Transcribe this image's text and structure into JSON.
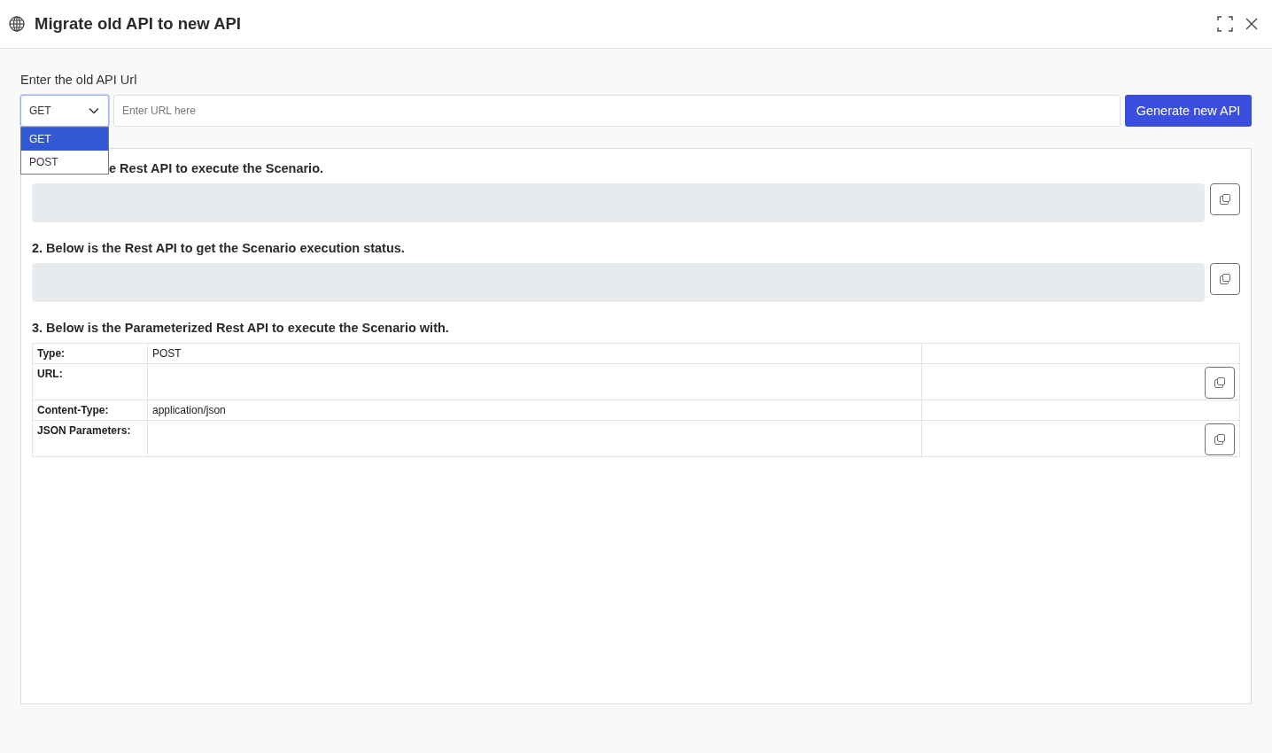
{
  "dialog": {
    "title": "Migrate old API to new API"
  },
  "old_api": {
    "label": "Enter the old API Url",
    "method_select": {
      "value": "GET",
      "open": true,
      "options": [
        {
          "label": "GET",
          "selected": true
        },
        {
          "label": "POST",
          "selected": false
        }
      ]
    },
    "url_input": {
      "placeholder": "Enter URL here"
    },
    "generate_button": "Generate new API"
  },
  "sections": [
    {
      "kind": "code_box",
      "heading": "e Rest API to execute the Scenario."
    },
    {
      "kind": "code_box",
      "heading": "2. Below is the Rest API to get the Scenario execution status."
    },
    {
      "kind": "table",
      "heading": "3. Below is the Parameterized Rest API to execute the Scenario with.",
      "rows": [
        {
          "label": "Type:",
          "value": "POST",
          "copy": false
        },
        {
          "label": "URL:",
          "copy": true
        },
        {
          "label": "Content-Type:",
          "value": "application/json",
          "copy": false
        },
        {
          "label": "JSON Parameters:",
          "copy": true
        }
      ]
    }
  ]
}
